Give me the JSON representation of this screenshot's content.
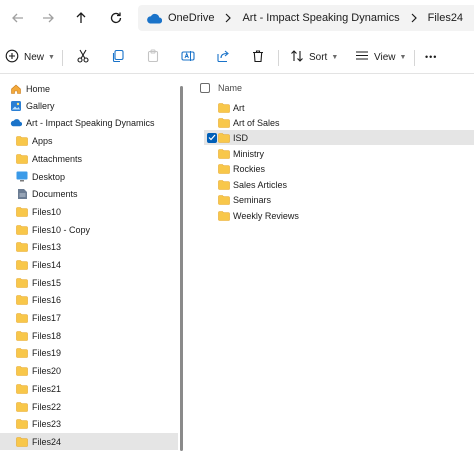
{
  "address_bar": {
    "back_icon": "arrow-left-icon",
    "forward_icon": "arrow-right-icon",
    "up_icon": "arrow-up-icon",
    "refresh_icon": "refresh-icon",
    "crumbs": [
      "OneDrive",
      "Art - Impact Speaking Dynamics",
      "Files24"
    ]
  },
  "toolbar": {
    "new_label": "New",
    "sort_label": "Sort",
    "view_label": "View",
    "more_label": "•••"
  },
  "sidebar": {
    "items": [
      {
        "label": "Home",
        "icon": "home-icon"
      },
      {
        "label": "Gallery",
        "icon": "gallery-icon"
      },
      {
        "label": "Art - Impact Speaking Dynamics",
        "icon": "onedrive-cloud-icon"
      },
      {
        "label": "Apps",
        "icon": "folder-icon"
      },
      {
        "label": "Attachments",
        "icon": "folder-icon"
      },
      {
        "label": "Desktop",
        "icon": "desktop-icon"
      },
      {
        "label": "Documents",
        "icon": "documents-icon"
      },
      {
        "label": "Files10",
        "icon": "folder-icon"
      },
      {
        "label": "Files10 - Copy",
        "icon": "folder-icon"
      },
      {
        "label": "Files13",
        "icon": "folder-icon"
      },
      {
        "label": "Files14",
        "icon": "folder-icon"
      },
      {
        "label": "Files15",
        "icon": "folder-icon"
      },
      {
        "label": "Files16",
        "icon": "folder-icon"
      },
      {
        "label": "Files17",
        "icon": "folder-icon"
      },
      {
        "label": "Files18",
        "icon": "folder-icon"
      },
      {
        "label": "Files19",
        "icon": "folder-icon"
      },
      {
        "label": "Files20",
        "icon": "folder-icon"
      },
      {
        "label": "Files21",
        "icon": "folder-icon"
      },
      {
        "label": "Files22",
        "icon": "folder-icon"
      },
      {
        "label": "Files23",
        "icon": "folder-icon"
      },
      {
        "label": "Files24",
        "icon": "folder-icon",
        "selected": true
      }
    ]
  },
  "content": {
    "column_name": "Name",
    "files": [
      {
        "name": "Art",
        "checked": false
      },
      {
        "name": "Art of Sales",
        "checked": false
      },
      {
        "name": "ISD",
        "checked": true
      },
      {
        "name": "Ministry",
        "checked": false
      },
      {
        "name": "Rockies",
        "checked": false
      },
      {
        "name": "Sales Articles",
        "checked": false
      },
      {
        "name": "Seminars",
        "checked": false
      },
      {
        "name": "Weekly Reviews",
        "checked": false
      }
    ]
  },
  "colors": {
    "folder": "#f8c74a",
    "folder_dark": "#e8a92a",
    "accent": "#005fb8",
    "onedrive": "#1a73c9",
    "selection": "#e5e5e5"
  }
}
